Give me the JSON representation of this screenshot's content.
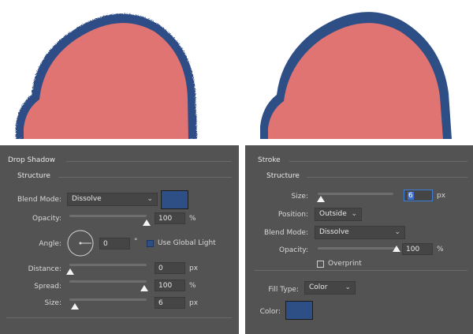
{
  "colors": {
    "fill": "#df7473",
    "stroke": "#2e4e86",
    "panel": "#535353"
  },
  "drop_shadow": {
    "title": "Drop Shadow",
    "section": "Structure",
    "blend_mode_label": "Blend Mode:",
    "blend_mode_value": "Dissolve",
    "opacity_label": "Opacity:",
    "opacity_value": "100",
    "opacity_unit": "%",
    "opacity_level": 1.0,
    "angle_label": "Angle:",
    "angle_value": "0",
    "angle_unit": "°",
    "global_light_label": "Use Global Light",
    "distance_label": "Distance:",
    "distance_value": "0",
    "distance_unit": "px",
    "spread_label": "Spread:",
    "spread_value": "100",
    "spread_unit": "%",
    "size_label": "Size:",
    "size_value": "6",
    "size_unit": "px"
  },
  "stroke": {
    "title": "Stroke",
    "section": "Structure",
    "size_label": "Size:",
    "size_value": "6",
    "size_unit": "px",
    "position_label": "Position:",
    "position_value": "Outside",
    "blend_mode_label": "Blend Mode:",
    "blend_mode_value": "Dissolve",
    "opacity_label": "Opacity:",
    "opacity_value": "100",
    "opacity_unit": "%",
    "opacity_level": 1.0,
    "overprint_label": "Overprint",
    "fill_type_label": "Fill Type:",
    "fill_type_value": "Color",
    "color_label": "Color:"
  }
}
